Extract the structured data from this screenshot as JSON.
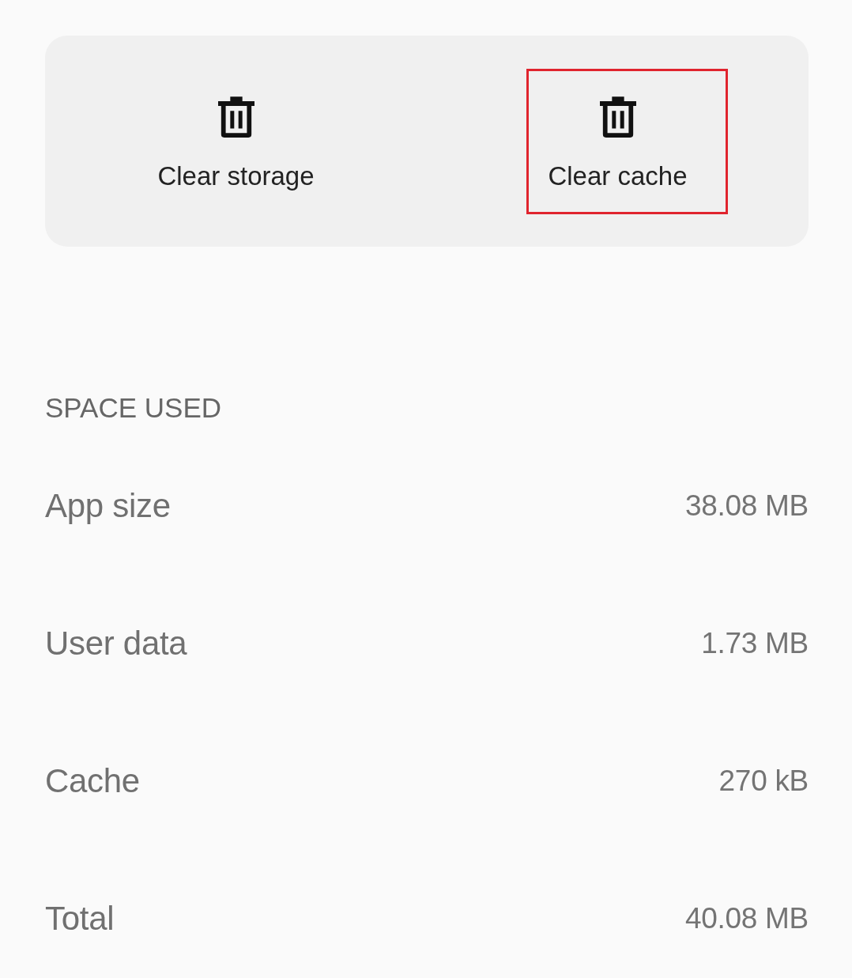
{
  "actions": [
    {
      "label": "Clear storage",
      "highlighted": false
    },
    {
      "label": "Clear cache",
      "highlighted": true
    }
  ],
  "space_used": {
    "heading": "SPACE USED",
    "rows": [
      {
        "label": "App size",
        "value": "38.08 MB"
      },
      {
        "label": "User data",
        "value": "1.73 MB"
      },
      {
        "label": "Cache",
        "value": "270 kB"
      },
      {
        "label": "Total",
        "value": "40.08 MB"
      }
    ]
  }
}
